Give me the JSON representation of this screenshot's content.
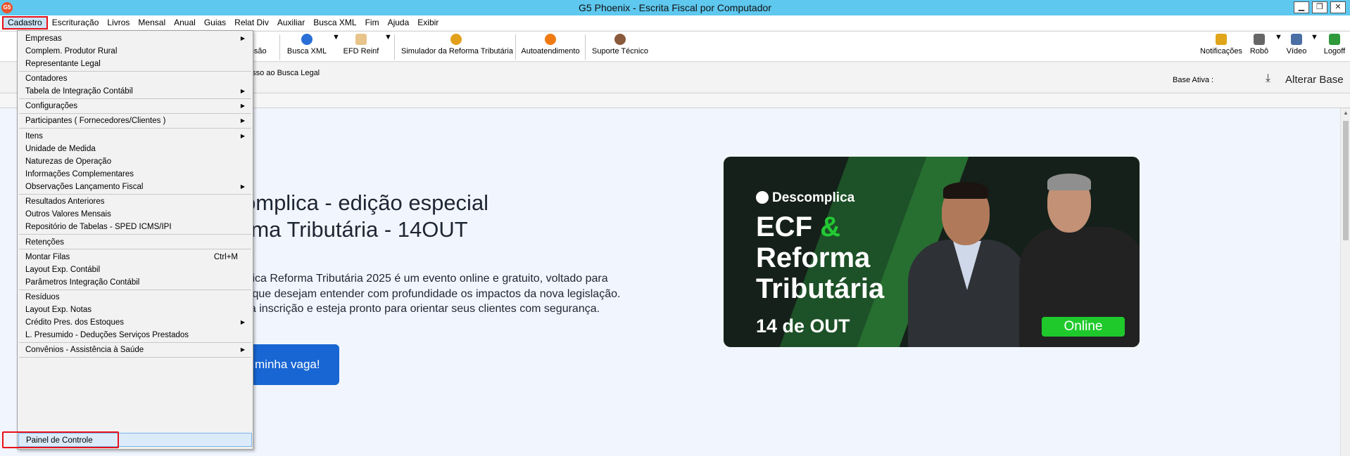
{
  "window": {
    "title": "G5 Phoenix - Escrita Fiscal por Computador",
    "app_icon_text": "G5",
    "minimize": "▁",
    "restore": "❐",
    "close": "✕"
  },
  "menubar": [
    "Cadastro",
    "Escrituração",
    "Livros",
    "Mensal",
    "Anual",
    "Guias",
    "Relat Div",
    "Auxiliar",
    "Busca XML",
    "Fim",
    "Ajuda",
    "Exibir"
  ],
  "toolbar": {
    "partial_left": "ssão",
    "items": [
      "Busca XML",
      "EFD Reinf",
      "Simulador da Reforma Tributária",
      "Autoatendimento",
      "Suporte Técnico"
    ],
    "right_items": [
      "Notificações",
      "Robô",
      "Vídeo",
      "Logoff"
    ],
    "dropdown_arrow": "▼"
  },
  "subbar": {
    "busca_legal": "esso ao Busca Legal",
    "base_ativa": "Base Ativa :",
    "alterar_base": "Alterar Base",
    "download_icon": "⤓"
  },
  "content": {
    "headline": "omplica - edição especial\nrma Tributária - 14OUT",
    "description": "plica Reforma Tributária 2025 é um evento online e gratuito, voltado para\ns que desejam entender com profundidade os impactos da nova legislação.\nua inscrição e esteja pronto para orientar seus clientes com segurança.",
    "cta_label": "minha vaga!",
    "banner": {
      "brand": "Descomplica",
      "line1": "ECF",
      "amp": "&",
      "line2": "Reforma",
      "line3": "Tributária",
      "date": "14 de OUT",
      "badge": "Online"
    }
  },
  "dropdown": {
    "submenu_arrow": "▶",
    "items": [
      {
        "label": "Empresas",
        "submenu": true
      },
      {
        "label": "Complem. Produtor Rural"
      },
      {
        "label": "Representante Legal"
      },
      {
        "label": "Contadores"
      },
      {
        "label": "Tabela de Integração Contábil",
        "submenu": true
      },
      {
        "label": "Configurações",
        "submenu": true
      },
      {
        "label": "Participantes ( Fornecedores/Clientes )",
        "submenu": true
      },
      {
        "label": "Itens",
        "submenu": true
      },
      {
        "label": "Unidade de Medida"
      },
      {
        "label": "Naturezas de Operação"
      },
      {
        "label": "Informações Complementares"
      },
      {
        "label": "Observações Lançamento Fiscal",
        "submenu": true
      },
      {
        "label": "Resultados Anteriores"
      },
      {
        "label": "Outros Valores Mensais"
      },
      {
        "label": "Repositório de Tabelas - SPED ICMS/IPI"
      },
      {
        "label": "Retenções"
      },
      {
        "label": "Montar Filas",
        "shortcut": "Ctrl+M"
      },
      {
        "label": "Layout Exp. Contábil"
      },
      {
        "label": "Parâmetros Integração Contábil"
      },
      {
        "label": "Resíduos"
      },
      {
        "label": "Layout Exp. Notas"
      },
      {
        "label": "Crédito Pres. dos Estoques",
        "submenu": true
      },
      {
        "label": "L. Presumido - Deduções Serviços Prestados"
      },
      {
        "label": "Convênios - Assistência à Saúde",
        "submenu": true
      },
      {
        "label": "Painel de Controle",
        "highlighted": true
      }
    ]
  }
}
